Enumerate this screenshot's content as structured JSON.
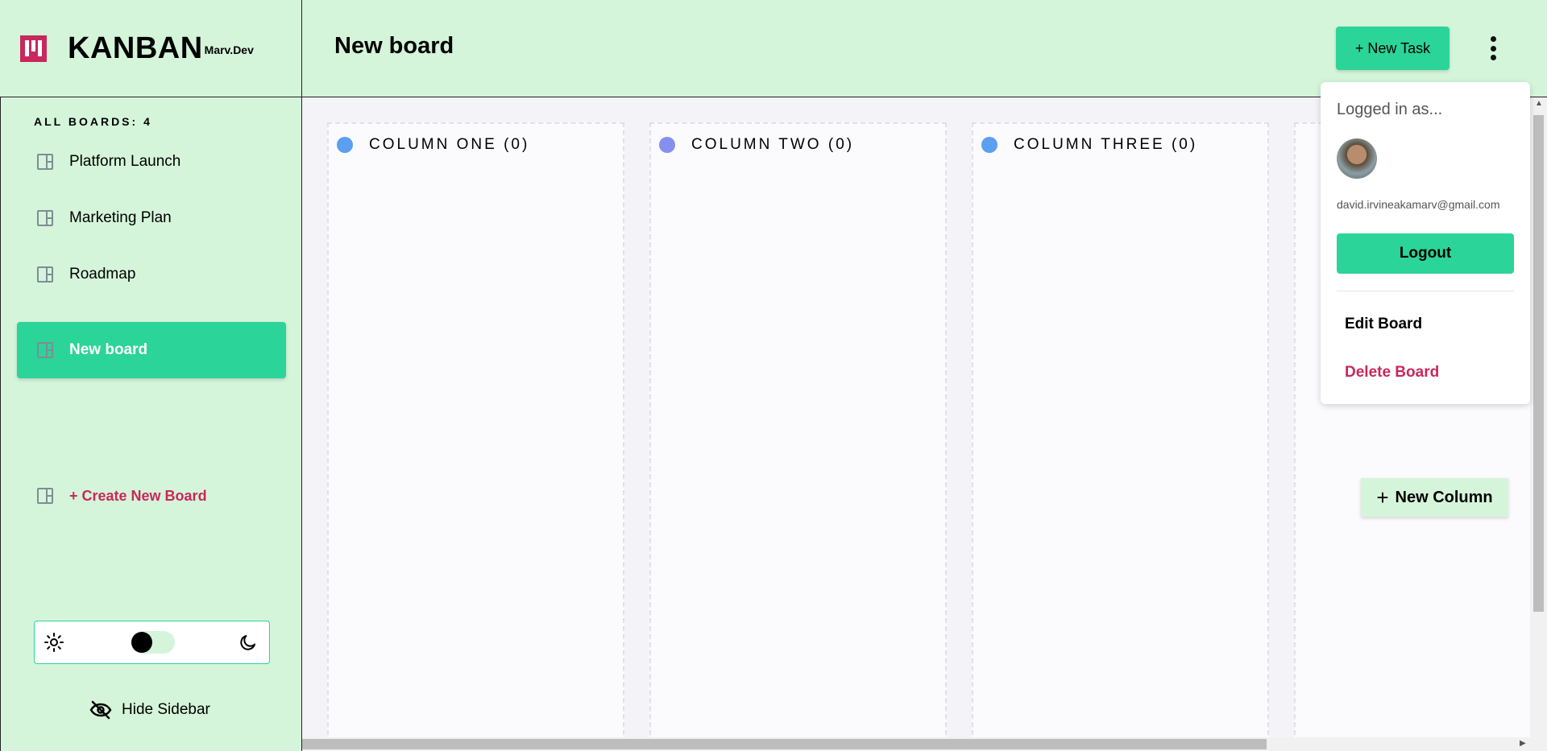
{
  "brand": {
    "name": "KANBAN",
    "sub": "Marv.Dev"
  },
  "header": {
    "board_title": "New board",
    "new_task_label": "+ New Task"
  },
  "sidebar": {
    "all_boards_label": "ALL BOARDS: 4",
    "boards": [
      {
        "label": "Platform Launch",
        "active": false
      },
      {
        "label": "Marketing Plan",
        "active": false
      },
      {
        "label": "Roadmap",
        "active": false
      },
      {
        "label": "New board",
        "active": true
      }
    ],
    "create_label": "+ Create New Board",
    "hide_label": "Hide Sidebar",
    "theme": "light"
  },
  "columns": [
    {
      "title": "COLUMN ONE (0)",
      "color": "#5b9ff0"
    },
    {
      "title": "COLUMN TWO (0)",
      "color": "#8590ee"
    },
    {
      "title": "COLUMN THREE (0)",
      "color": "#5b9ff0"
    }
  ],
  "new_column_label": "New Column",
  "dropdown": {
    "logged_in_label": "Logged in as...",
    "email": "david.irvineakamarv@gmail.com",
    "logout_label": "Logout",
    "edit_label": "Edit Board",
    "delete_label": "Delete Board"
  },
  "colors": {
    "accent": "#2bd498",
    "mint": "#d5f5da",
    "danger": "#c8285c"
  }
}
